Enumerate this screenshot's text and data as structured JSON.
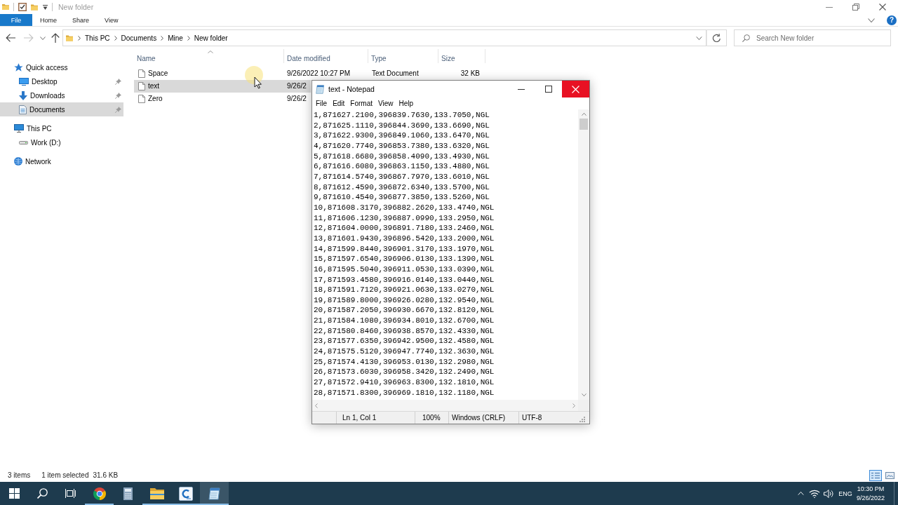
{
  "explorer": {
    "title": "New folder",
    "ribbon_tabs": [
      {
        "label": "File",
        "kind": "menu"
      },
      {
        "label": "Home",
        "kind": "tab"
      },
      {
        "label": "Share",
        "kind": "tab"
      },
      {
        "label": "View",
        "kind": "tab"
      }
    ],
    "help_label": "?",
    "back": {
      "disabled": false
    },
    "forward": {
      "disabled": true
    },
    "breadcrumb": [
      "This PC",
      "Documents",
      "Mine",
      "New folder"
    ],
    "search": {
      "placeholder": "Search New folder"
    },
    "sidebar": [
      {
        "label": "Quick access",
        "selected": false,
        "children": [
          {
            "label": "Desktop",
            "selected": false,
            "pinned": true
          },
          {
            "label": "Downloads",
            "selected": false,
            "pinned": true
          },
          {
            "label": "Documents",
            "selected": true,
            "pinned": true
          }
        ]
      },
      {
        "label": "This PC",
        "selected": false,
        "children": [
          {
            "label": "Work (D:)",
            "selected": false
          }
        ]
      },
      {
        "label": "Network",
        "selected": false
      }
    ],
    "columns": [
      {
        "label": "Name",
        "sorted": true
      },
      {
        "label": "Date modified",
        "sorted": false
      },
      {
        "label": "Type",
        "sorted": false
      },
      {
        "label": "Size",
        "sorted": false
      }
    ],
    "files": [
      {
        "name": "Space",
        "date_modified": "9/26/2022 10:27 PM",
        "type": "Text Document",
        "size": "32 KB",
        "selected": false
      },
      {
        "name": "text",
        "date_modified": "9/26/2",
        "selected": true
      },
      {
        "name": "Zero",
        "date_modified": "9/26/2",
        "selected": false
      }
    ],
    "status_bar": {
      "item_count": "3 items",
      "selection": "1 item selected",
      "selection_size": "31.6 KB"
    },
    "view_buttons": [
      {
        "selected": true
      },
      {
        "selected": false
      }
    ]
  },
  "notepad": {
    "title": "text - Notepad",
    "menu": [
      "File",
      "Edit",
      "Format",
      "View",
      "Help"
    ],
    "lines": [
      "1,871627.2100,396839.7630,133.7050,NGL",
      "2,871625.1110,396844.3690,133.6690,NGL",
      "3,871622.9300,396849.1060,133.6470,NGL",
      "4,871620.7740,396853.7380,133.6320,NGL",
      "5,871618.6680,396858.4090,133.4930,NGL",
      "6,871616.6080,396863.1150,133.4880,NGL",
      "7,871614.5740,396867.7970,133.6010,NGL",
      "8,871612.4590,396872.6340,133.5700,NGL",
      "9,871610.4540,396877.3850,133.5260,NGL",
      "10,871608.3170,396882.2620,133.4740,NGL",
      "11,871606.1230,396887.0990,133.2950,NGL",
      "12,871604.0000,396891.7180,133.2460,NGL",
      "13,871601.9430,396896.5420,133.2000,NGL",
      "14,871599.8440,396901.3170,133.1970,NGL",
      "15,871597.6540,396906.0130,133.1390,NGL",
      "16,871595.5040,396911.0530,133.0390,NGL",
      "17,871593.4580,396916.0140,133.0440,NGL",
      "18,871591.7120,396921.0630,133.0270,NGL",
      "19,871589.8000,396926.0280,132.9540,NGL",
      "20,871587.2050,396930.6670,132.8120,NGL",
      "21,871584.1080,396934.8010,132.6700,NGL",
      "22,871580.8460,396938.8570,132.4330,NGL",
      "23,871577.6350,396942.9500,132.4580,NGL",
      "24,871575.5120,396947.7740,132.3630,NGL",
      "25,871574.4130,396953.0130,132.2980,NGL",
      "26,871573.6030,396958.3420,132.2490,NGL",
      "27,871572.9410,396963.8300,132.1810,NGL",
      "28,871571.8300,396969.1810,132.1180,NGL"
    ],
    "status": {
      "position": "Ln 1, Col 1",
      "zoom": "100%",
      "line_ending": "Windows (CRLF)",
      "encoding": "UTF-8"
    }
  },
  "taskbar": {
    "apps": [
      {
        "running": true,
        "active": false
      },
      {
        "running": false,
        "active": false
      },
      {
        "running": true,
        "active": false
      },
      {
        "running": true,
        "active": false
      },
      {
        "running": true,
        "active": true
      }
    ],
    "language": "ENG",
    "time": "10:30 PM",
    "date": "9/26/2022"
  }
}
